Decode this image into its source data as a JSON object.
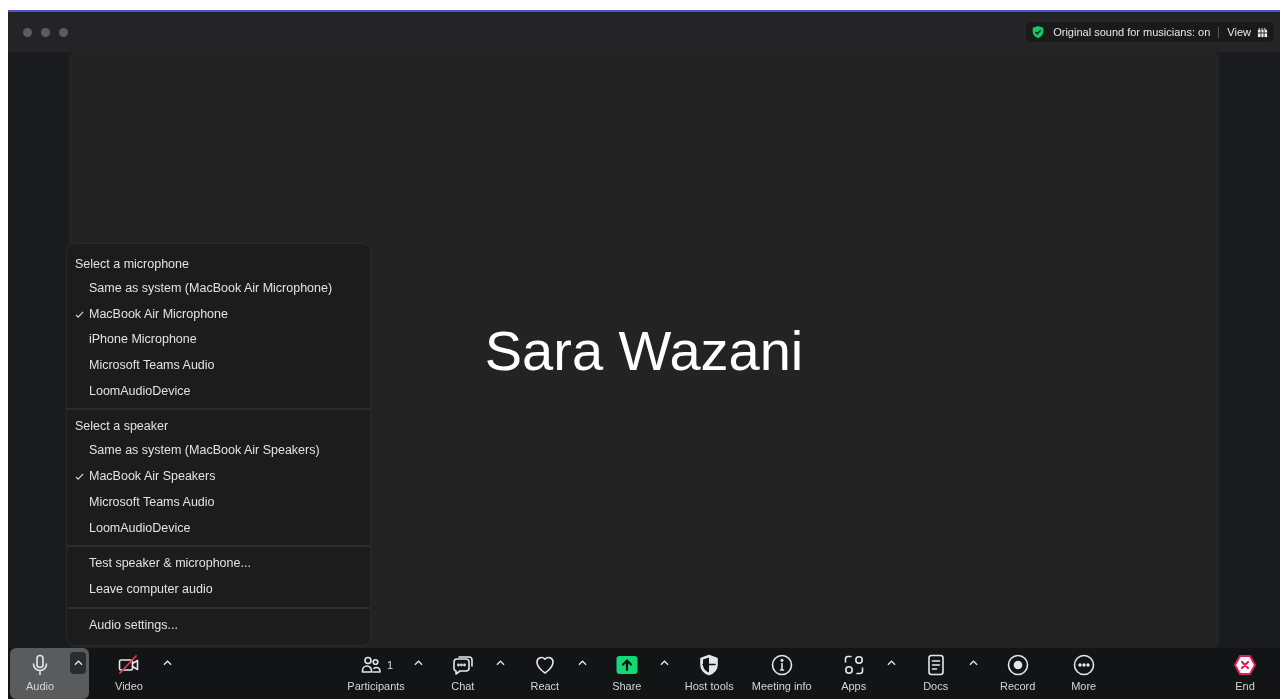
{
  "title_bar": {
    "badge": "Original sound for musicians: on",
    "view_button": "View"
  },
  "stage": {
    "participant_name": "Sara Wazani"
  },
  "audio_menu": {
    "sections": [
      {
        "kind": "choice",
        "heading": "Select a microphone",
        "items": [
          {
            "label": "Same as system (MacBook Air Microphone)",
            "selected": false
          },
          {
            "label": "MacBook Air Microphone",
            "selected": true
          },
          {
            "label": "iPhone Microphone",
            "selected": false
          },
          {
            "label": "Microsoft Teams Audio",
            "selected": false
          },
          {
            "label": "LoomAudioDevice",
            "selected": false
          }
        ]
      },
      {
        "kind": "choice",
        "heading": "Select a speaker",
        "items": [
          {
            "label": "Same as system (MacBook Air Speakers)",
            "selected": false
          },
          {
            "label": "MacBook Air Speakers",
            "selected": true
          },
          {
            "label": "Microsoft Teams Audio",
            "selected": false
          },
          {
            "label": "LoomAudioDevice",
            "selected": false
          }
        ]
      },
      {
        "kind": "action",
        "items": [
          {
            "label": "Test speaker & microphone..."
          },
          {
            "label": "Leave computer audio"
          }
        ]
      },
      {
        "kind": "action",
        "items": [
          {
            "label": "Audio settings..."
          }
        ]
      }
    ]
  },
  "toolbar": {
    "left": [
      {
        "label": "Audio",
        "expanded": true,
        "muted": false,
        "has_menu": true
      },
      {
        "label": "Video",
        "expanded": false,
        "muted": true,
        "has_menu": true
      }
    ],
    "center": [
      {
        "label": "Participants",
        "count": "1",
        "has_menu": true
      },
      {
        "label": "Chat",
        "has_menu": true
      },
      {
        "label": "React",
        "has_menu": true
      },
      {
        "label": "Share",
        "has_menu": true
      },
      {
        "label": "Host tools",
        "has_menu": false
      },
      {
        "label": "Meeting info",
        "has_menu": false
      },
      {
        "label": "Apps",
        "has_menu": true
      },
      {
        "label": "Docs",
        "has_menu": true
      },
      {
        "label": "Record",
        "has_menu": false
      },
      {
        "label": "More",
        "has_menu": false
      }
    ],
    "end_button": "End"
  }
}
